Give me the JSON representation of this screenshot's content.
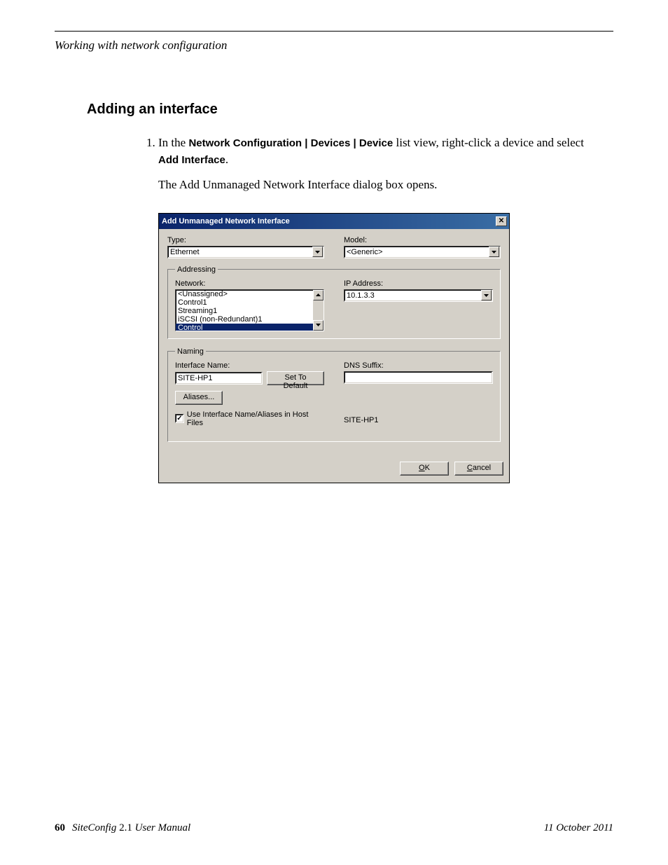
{
  "runningHead": "Working with network configuration",
  "heading": "Adding an interface",
  "step1_pre": "In the ",
  "step1_bold1": "Network Configuration | Devices | Device",
  "step1_mid": " list view, right-click a device and select ",
  "step1_bold2": "Add Interface",
  "step1_post": ".",
  "afterStep": "The Add Unmanaged Network Interface dialog box opens.",
  "dialog": {
    "title": "Add Unmanaged Network Interface",
    "type": {
      "label": "Type:",
      "value": "Ethernet"
    },
    "model": {
      "label": "Model:",
      "value": "<Generic>"
    },
    "addressing": {
      "legend": "Addressing",
      "networkLabel": "Network:",
      "networkItems": [
        "<Unassigned>",
        "Control1",
        "Streaming1",
        "iSCSI (non-Redundant)1",
        "Control"
      ],
      "networkSelectedIndex": 4,
      "ipLabel": "IP Address:",
      "ipValue": "10.1.3.3"
    },
    "naming": {
      "legend": "Naming",
      "ifaceLabel": "Interface Name:",
      "ifaceValue": "SITE-HP1",
      "setDefault": "Set To Default",
      "aliases": "Aliases...",
      "useHostFiles": "Use Interface Name/Aliases in Host Files",
      "dnsLabel": "DNS Suffix:",
      "dnsValue": "",
      "resolved": "SITE-HP1"
    },
    "ok": "OK",
    "cancel": "Cancel"
  },
  "footer": {
    "pageNo": "60",
    "product": "SiteConfig",
    "version": " 2.1 ",
    "manual": "User Manual",
    "date": "11 October 2011"
  }
}
